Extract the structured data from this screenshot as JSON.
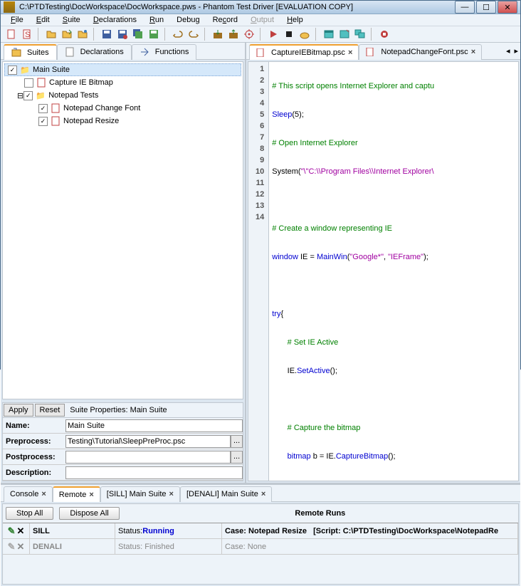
{
  "title": "C:\\PTDTesting\\DocWorkspace\\DocWorkspace.pws - Phantom Test Driver [EVALUATION COPY]",
  "menu": {
    "file": "File",
    "edit": "Edit",
    "suite": "Suite",
    "decl": "Declarations",
    "run": "Run",
    "debug": "Debug",
    "record": "Record",
    "output": "Output",
    "help": "Help"
  },
  "lefttabs": {
    "suites": "Suites",
    "decl": "Declarations",
    "func": "Functions"
  },
  "tree": {
    "main_suite": "Main Suite",
    "capture": "Capture IE Bitmap",
    "notepad": "Notepad Tests",
    "changefont": "Notepad Change Font",
    "resize": "Notepad Resize"
  },
  "propbtns": {
    "apply": "Apply",
    "reset": "Reset"
  },
  "proptitle": "Suite Properties: Main Suite",
  "props": {
    "name_lbl": "Name:",
    "name_val": "Main Suite",
    "pre_lbl": "Preprocess:",
    "pre_val": "Testing\\Tutorial\\SleepPreProc.psc",
    "post_lbl": "Postprocess:",
    "post_val": "",
    "desc_lbl": "Description:",
    "desc_val": ""
  },
  "codetabs": {
    "t1": "CaptureIEBitmap.psc",
    "t2": "NotepadChangeFont.psc"
  },
  "code": {
    "l1a": "# This script opens Internet Explorer and captu",
    "l2a": "Sleep",
    "l2b": "(5);",
    "l3a": "# Open Internet Explorer",
    "l4a": "System(",
    "l4b": "\"\\\"C:\\\\Program Files\\\\Internet Explorer\\",
    "l5": "",
    "l6a": "# Create a window representing IE",
    "l7a": "window",
    "l7b": " IE = ",
    "l7c": "MainWin",
    "l7d": "(",
    "l7e": "\"Google*\"",
    "l7f": ", ",
    "l7g": "\"IEFrame\"",
    "l7h": ");",
    "l8": "",
    "l9a": "try",
    "l9b": "{",
    "l10a": "       # Set IE Active",
    "l11a": "       IE.",
    "l11b": "SetActive",
    "l11c": "();",
    "l12": "",
    "l13a": "       # Capture the bitmap",
    "l14a": "       bitmap",
    "l14b": " b = IE.",
    "l14c": "CaptureBitmap",
    "l14d": "();"
  },
  "bottabs": {
    "console": "Console",
    "remote": "Remote",
    "sill": "[SILL] Main Suite",
    "denali": "[DENALI] Main Suite"
  },
  "botbtns": {
    "stop": "Stop All",
    "dispose": "Dispose All",
    "head": "Remote Runs"
  },
  "runs": {
    "r1_name": "SILL",
    "r1_status_lbl": "Status: ",
    "r1_status": "Running",
    "r1_case_lbl": "Case: ",
    "r1_case": "Notepad Resize",
    "r1_script_lbl": "[Script: ",
    "r1_script": "C:\\PTDTesting\\DocWorkspace\\NotepadRe",
    "r2_name": "DENALI",
    "r2_status": "Status: Finished",
    "r2_case": "Case: None"
  }
}
